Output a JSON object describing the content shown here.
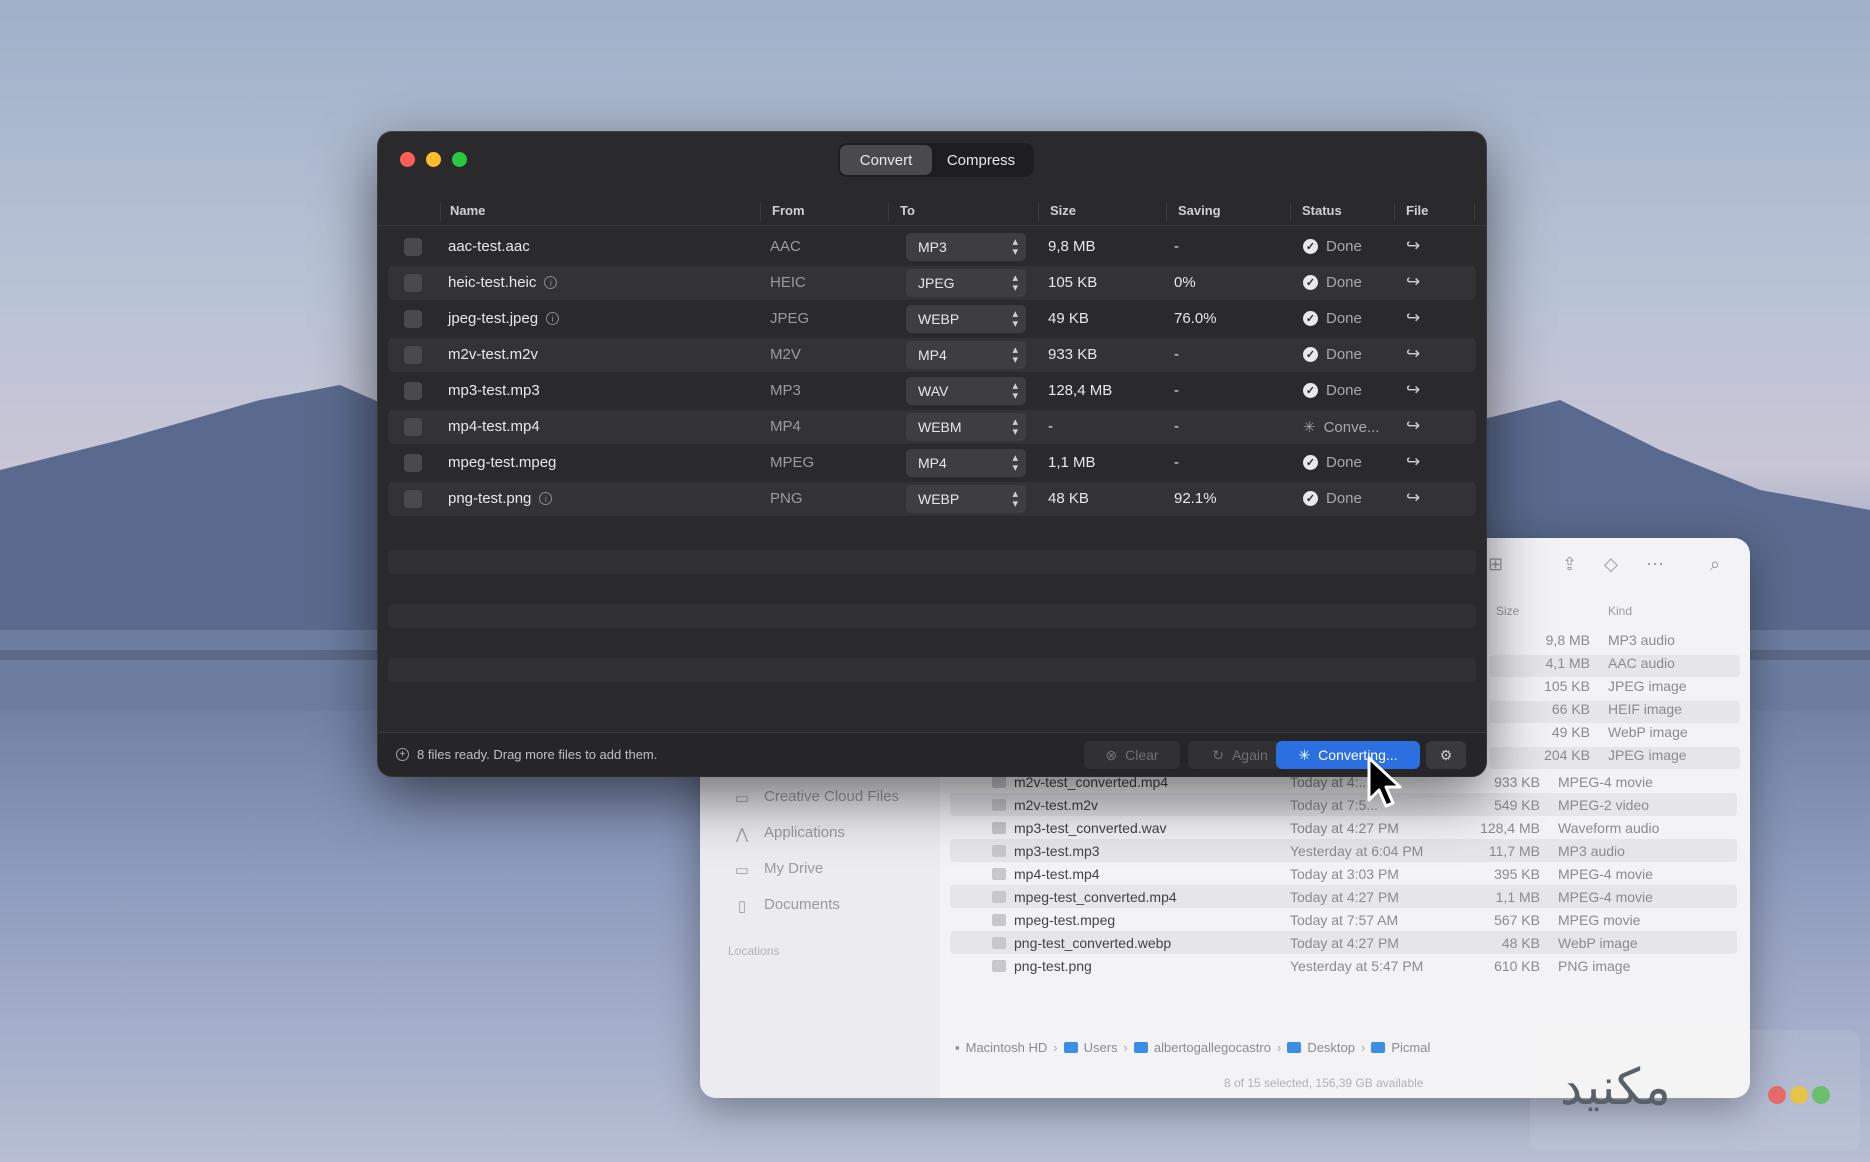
{
  "app": {
    "tabs": [
      {
        "label": "Convert",
        "active": true
      },
      {
        "label": "Compress",
        "active": false
      }
    ],
    "columns": {
      "name": "Name",
      "from": "From",
      "to": "To",
      "size": "Size",
      "saving": "Saving",
      "status": "Status",
      "file": "File"
    },
    "rows": [
      {
        "name": "aac-test.aac",
        "info": false,
        "from": "AAC",
        "to": "MP3",
        "size": "9,8 MB",
        "saving": "-",
        "status": "Done",
        "done": true
      },
      {
        "name": "heic-test.heic",
        "info": true,
        "from": "HEIC",
        "to": "JPEG",
        "size": "105 KB",
        "saving": "0%",
        "status": "Done",
        "done": true
      },
      {
        "name": "jpeg-test.jpeg",
        "info": true,
        "from": "JPEG",
        "to": "WEBP",
        "size": "49 KB",
        "saving": "76.0%",
        "status": "Done",
        "done": true
      },
      {
        "name": "m2v-test.m2v",
        "info": false,
        "from": "M2V",
        "to": "MP4",
        "size": "933 KB",
        "saving": "-",
        "status": "Done",
        "done": true
      },
      {
        "name": "mp3-test.mp3",
        "info": false,
        "from": "MP3",
        "to": "WAV",
        "size": "128,4 MB",
        "saving": "-",
        "status": "Done",
        "done": true
      },
      {
        "name": "mp4-test.mp4",
        "info": false,
        "from": "MP4",
        "to": "WEBM",
        "size": "-",
        "saving": "-",
        "status": "Conve...",
        "done": false
      },
      {
        "name": "mpeg-test.mpeg",
        "info": false,
        "from": "MPEG",
        "to": "MP4",
        "size": "1,1 MB",
        "saving": "-",
        "status": "Done",
        "done": true
      },
      {
        "name": "png-test.png",
        "info": true,
        "from": "PNG",
        "to": "WEBP",
        "size": "48 KB",
        "saving": "92.1%",
        "status": "Done",
        "done": true
      }
    ],
    "footer": {
      "message": "8 files ready. Drag more files to add them.",
      "clear_label": "Clear",
      "again_label": "Again",
      "convert_label": "Converting..."
    }
  },
  "finder": {
    "col_size": "Size",
    "col_kind": "Kind",
    "top_rows": [
      {
        "size": "9,8 MB",
        "kind": "MP3 audio"
      },
      {
        "size": "4,1 MB",
        "kind": "AAC audio"
      },
      {
        "size": "105 KB",
        "kind": "JPEG image"
      },
      {
        "size": "66 KB",
        "kind": "HEIF image"
      },
      {
        "size": "49 KB",
        "kind": "WebP image"
      },
      {
        "size": "204 KB",
        "kind": "JPEG image"
      }
    ],
    "rows": [
      {
        "name": "m2v-test_converted.mp4",
        "date": "Today at 4:...",
        "size": "933 KB",
        "kind": "MPEG-4 movie"
      },
      {
        "name": "m2v-test.m2v",
        "date": "Today at 7:5...",
        "size": "549 KB",
        "kind": "MPEG-2 video"
      },
      {
        "name": "mp3-test_converted.wav",
        "date": "Today at 4:27 PM",
        "size": "128,4 MB",
        "kind": "Waveform audio"
      },
      {
        "name": "mp3-test.mp3",
        "date": "Yesterday at 6:04 PM",
        "size": "11,7 MB",
        "kind": "MP3 audio"
      },
      {
        "name": "mp4-test.mp4",
        "date": "Today at 3:03 PM",
        "size": "395 KB",
        "kind": "MPEG-4 movie"
      },
      {
        "name": "mpeg-test_converted.mp4",
        "date": "Today at 4:27 PM",
        "size": "1,1 MB",
        "kind": "MPEG-4 movie"
      },
      {
        "name": "mpeg-test.mpeg",
        "date": "Today at 7:57 AM",
        "size": "567 KB",
        "kind": "MPEG movie"
      },
      {
        "name": "png-test_converted.webp",
        "date": "Today at 4:27 PM",
        "size": "48 KB",
        "kind": "WebP image"
      },
      {
        "name": "png-test.png",
        "date": "Yesterday at 5:47 PM",
        "size": "610 KB",
        "kind": "PNG image"
      }
    ],
    "sidebar": [
      {
        "label": "Creative Cloud Files",
        "icon": "folder-icon"
      },
      {
        "label": "Applications",
        "icon": "applications-icon"
      },
      {
        "label": "My Drive",
        "icon": "folder-icon"
      },
      {
        "label": "Documents",
        "icon": "document-icon"
      }
    ],
    "locations_label": "Locations",
    "path": [
      "Macintosh HD",
      "Users",
      "albertogallegocastro",
      "Desktop",
      "Picmal"
    ],
    "status": "8 of 15 selected, 156,39 GB available"
  },
  "watermark": {
    "text": "مکنید"
  }
}
